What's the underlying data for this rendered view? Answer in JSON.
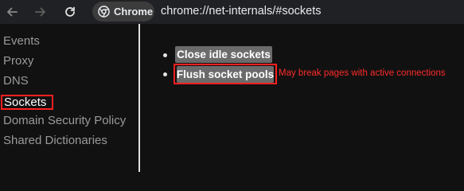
{
  "browser": {
    "chip_label": "Chrome",
    "url": "chrome://net-internals/#sockets",
    "icons": [
      "back-arrow-icon",
      "forward-arrow-icon",
      "reload-icon",
      "chrome-logo-icon"
    ]
  },
  "sidebar": {
    "items": [
      {
        "label": "Events"
      },
      {
        "label": "Proxy"
      },
      {
        "label": "DNS"
      },
      {
        "label": "Sockets",
        "selected": true
      },
      {
        "label": "Domain Security Policy"
      },
      {
        "label": "Shared Dictionaries"
      }
    ]
  },
  "main": {
    "close_idle_label": "Close idle sockets",
    "flush_pools_label": "Flush socket pools",
    "flush_warning": "May break pages with active connections"
  },
  "colors": {
    "background": "#111111",
    "toolbar": "#202124",
    "button": "#6b6b6b",
    "highlight": "#ff2020",
    "warning": "#ff2a2a"
  }
}
